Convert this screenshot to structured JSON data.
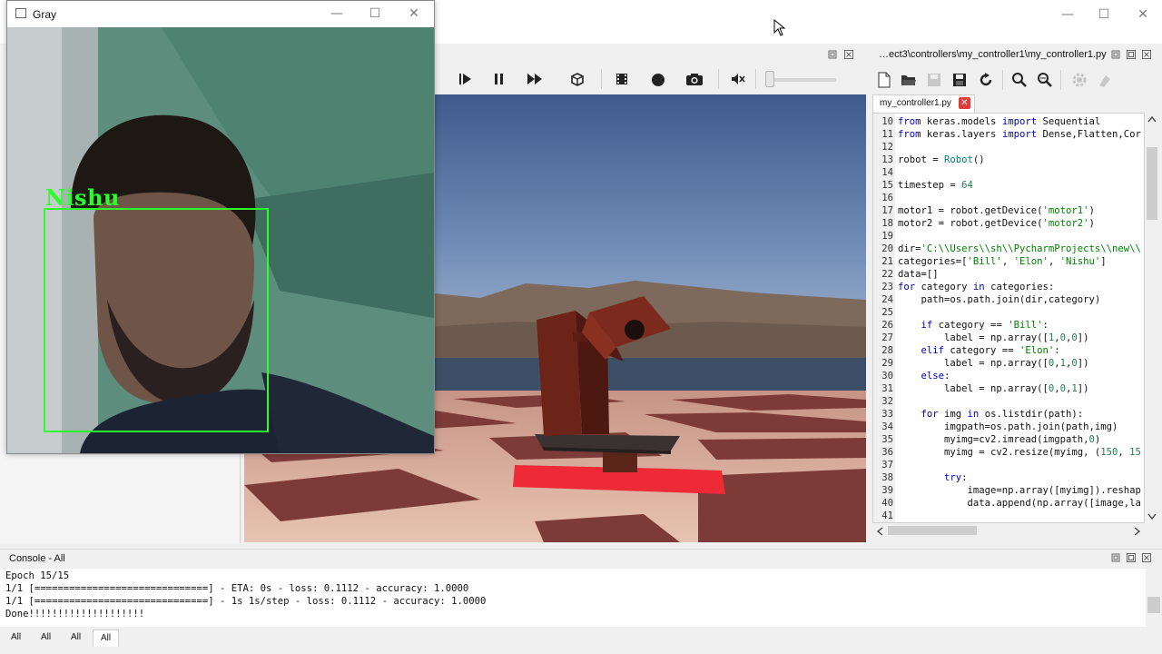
{
  "main_window": {
    "controls": {
      "minimize": "—",
      "maximize": "☐",
      "close": "✕"
    }
  },
  "sim_toolbar": {
    "icons": [
      "step-icon",
      "pause-icon",
      "fast-forward-icon",
      "box-icon",
      "film-icon",
      "record-icon",
      "camera-icon",
      "mute-icon",
      "speed-slider"
    ]
  },
  "editor": {
    "path": "…ect3\\controllers\\my_controller1\\my_controller1.py",
    "tab_label": "my_controller1.py",
    "tab_close": "✕",
    "lines": [
      {
        "n": "10",
        "code": "from keras.models import Sequential"
      },
      {
        "n": "11",
        "code": "from keras.layers import Dense,Flatten,Cor"
      },
      {
        "n": "12",
        "code": ""
      },
      {
        "n": "13",
        "code": "robot = Robot()"
      },
      {
        "n": "14",
        "code": ""
      },
      {
        "n": "15",
        "code": "timestep = 64"
      },
      {
        "n": "16",
        "code": ""
      },
      {
        "n": "17",
        "code": "motor1 = robot.getDevice('motor1')"
      },
      {
        "n": "18",
        "code": "motor2 = robot.getDevice('motor2')"
      },
      {
        "n": "19",
        "code": ""
      },
      {
        "n": "20",
        "code": "dir='C:\\\\Users\\\\sh\\\\PycharmProjects\\\\new\\\\"
      },
      {
        "n": "21",
        "code": "categories=['Bill', 'Elon', 'Nishu']"
      },
      {
        "n": "22",
        "code": "data=[]"
      },
      {
        "n": "23",
        "code": "for category in categories:"
      },
      {
        "n": "24",
        "code": "    path=os.path.join(dir,category)"
      },
      {
        "n": "25",
        "code": ""
      },
      {
        "n": "26",
        "code": "    if category == 'Bill':"
      },
      {
        "n": "27",
        "code": "        label = np.array([1,0,0])"
      },
      {
        "n": "28",
        "code": "    elif category == 'Elon':"
      },
      {
        "n": "29",
        "code": "        label = np.array([0,1,0])"
      },
      {
        "n": "30",
        "code": "    else:"
      },
      {
        "n": "31",
        "code": "        label = np.array([0,0,1])"
      },
      {
        "n": "32",
        "code": ""
      },
      {
        "n": "33",
        "code": "    for img in os.listdir(path):"
      },
      {
        "n": "34",
        "code": "        imgpath=os.path.join(path,img)"
      },
      {
        "n": "35",
        "code": "        myimg=cv2.imread(imgpath,0)"
      },
      {
        "n": "36",
        "code": "        myimg = cv2.resize(myimg, (150, 15"
      },
      {
        "n": "37",
        "code": ""
      },
      {
        "n": "38",
        "code": "        try:"
      },
      {
        "n": "39",
        "code": "            image=np.array([myimg]).reshap"
      },
      {
        "n": "40",
        "code": "            data.append(np.array([image,la"
      },
      {
        "n": "41",
        "code": ""
      }
    ]
  },
  "console": {
    "title": "Console - All",
    "lines": [
      "Epoch 15/15",
      "1/1 [==============================] - ETA: 0s - loss: 0.1112 - accuracy: 1.0000",
      "1/1 [==============================] - 1s 1s/step - loss: 0.1112 - accuracy: 1.0000",
      "Done!!!!!!!!!!!!!!!!!!!!"
    ],
    "tabs": [
      "All",
      "All",
      "All",
      "All"
    ]
  },
  "camera_window": {
    "title": "Gray",
    "detection_label": "Nishu",
    "box_color": "#2bff2b",
    "controls": {
      "minimize": "—",
      "maximize": "☐",
      "close": "✕"
    }
  },
  "colors": {
    "keyword": "#0000c0",
    "string": "#008000",
    "number": "#208050",
    "builtin": "#008080"
  }
}
